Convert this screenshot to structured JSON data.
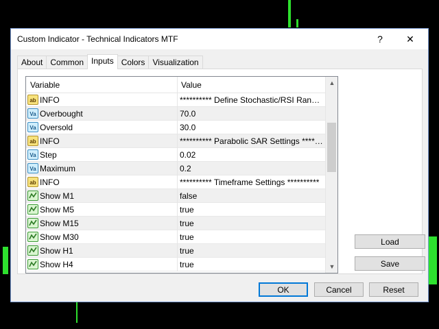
{
  "window": {
    "title": "Custom Indicator - Technical Indicators MTF",
    "help_label": "?",
    "close_label": "✕"
  },
  "tabs": [
    {
      "label": "About"
    },
    {
      "label": "Common"
    },
    {
      "label": "Inputs"
    },
    {
      "label": "Colors"
    },
    {
      "label": "Visualization"
    }
  ],
  "active_tab": "Inputs",
  "table": {
    "col_variable": "Variable",
    "col_value": "Value",
    "rows": [
      {
        "icon": "ab",
        "icon_text": "ab",
        "variable": "INFO",
        "value": "********** Define Stochastic/RSI Range ***..."
      },
      {
        "icon": "va",
        "icon_text": "Va",
        "variable": "Overbought",
        "value": "70.0"
      },
      {
        "icon": "va",
        "icon_text": "Va",
        "variable": "Oversold",
        "value": "30.0"
      },
      {
        "icon": "ab",
        "icon_text": "ab",
        "variable": "INFO",
        "value": "********** Parabolic SAR Settings **********"
      },
      {
        "icon": "va",
        "icon_text": "Va",
        "variable": "Step",
        "value": "0.02"
      },
      {
        "icon": "va",
        "icon_text": "Va",
        "variable": "Maximum",
        "value": "0.2"
      },
      {
        "icon": "ab",
        "icon_text": "ab",
        "variable": "INFO",
        "value": "********** Timeframe Settings **********"
      },
      {
        "icon": "bool",
        "icon_text": "",
        "variable": "Show M1",
        "value": "false"
      },
      {
        "icon": "bool",
        "icon_text": "",
        "variable": "Show M5",
        "value": "true"
      },
      {
        "icon": "bool",
        "icon_text": "",
        "variable": "Show M15",
        "value": "true"
      },
      {
        "icon": "bool",
        "icon_text": "",
        "variable": "Show M30",
        "value": "true"
      },
      {
        "icon": "bool",
        "icon_text": "",
        "variable": "Show H1",
        "value": "true"
      },
      {
        "icon": "bool",
        "icon_text": "",
        "variable": "Show H4",
        "value": "true"
      }
    ]
  },
  "side_buttons": {
    "load": "Load",
    "save": "Save"
  },
  "footer_buttons": {
    "ok": "OK",
    "cancel": "Cancel",
    "reset": "Reset"
  },
  "colors": {
    "chart_line": "#2ee02e",
    "accent": "#0078d7"
  }
}
